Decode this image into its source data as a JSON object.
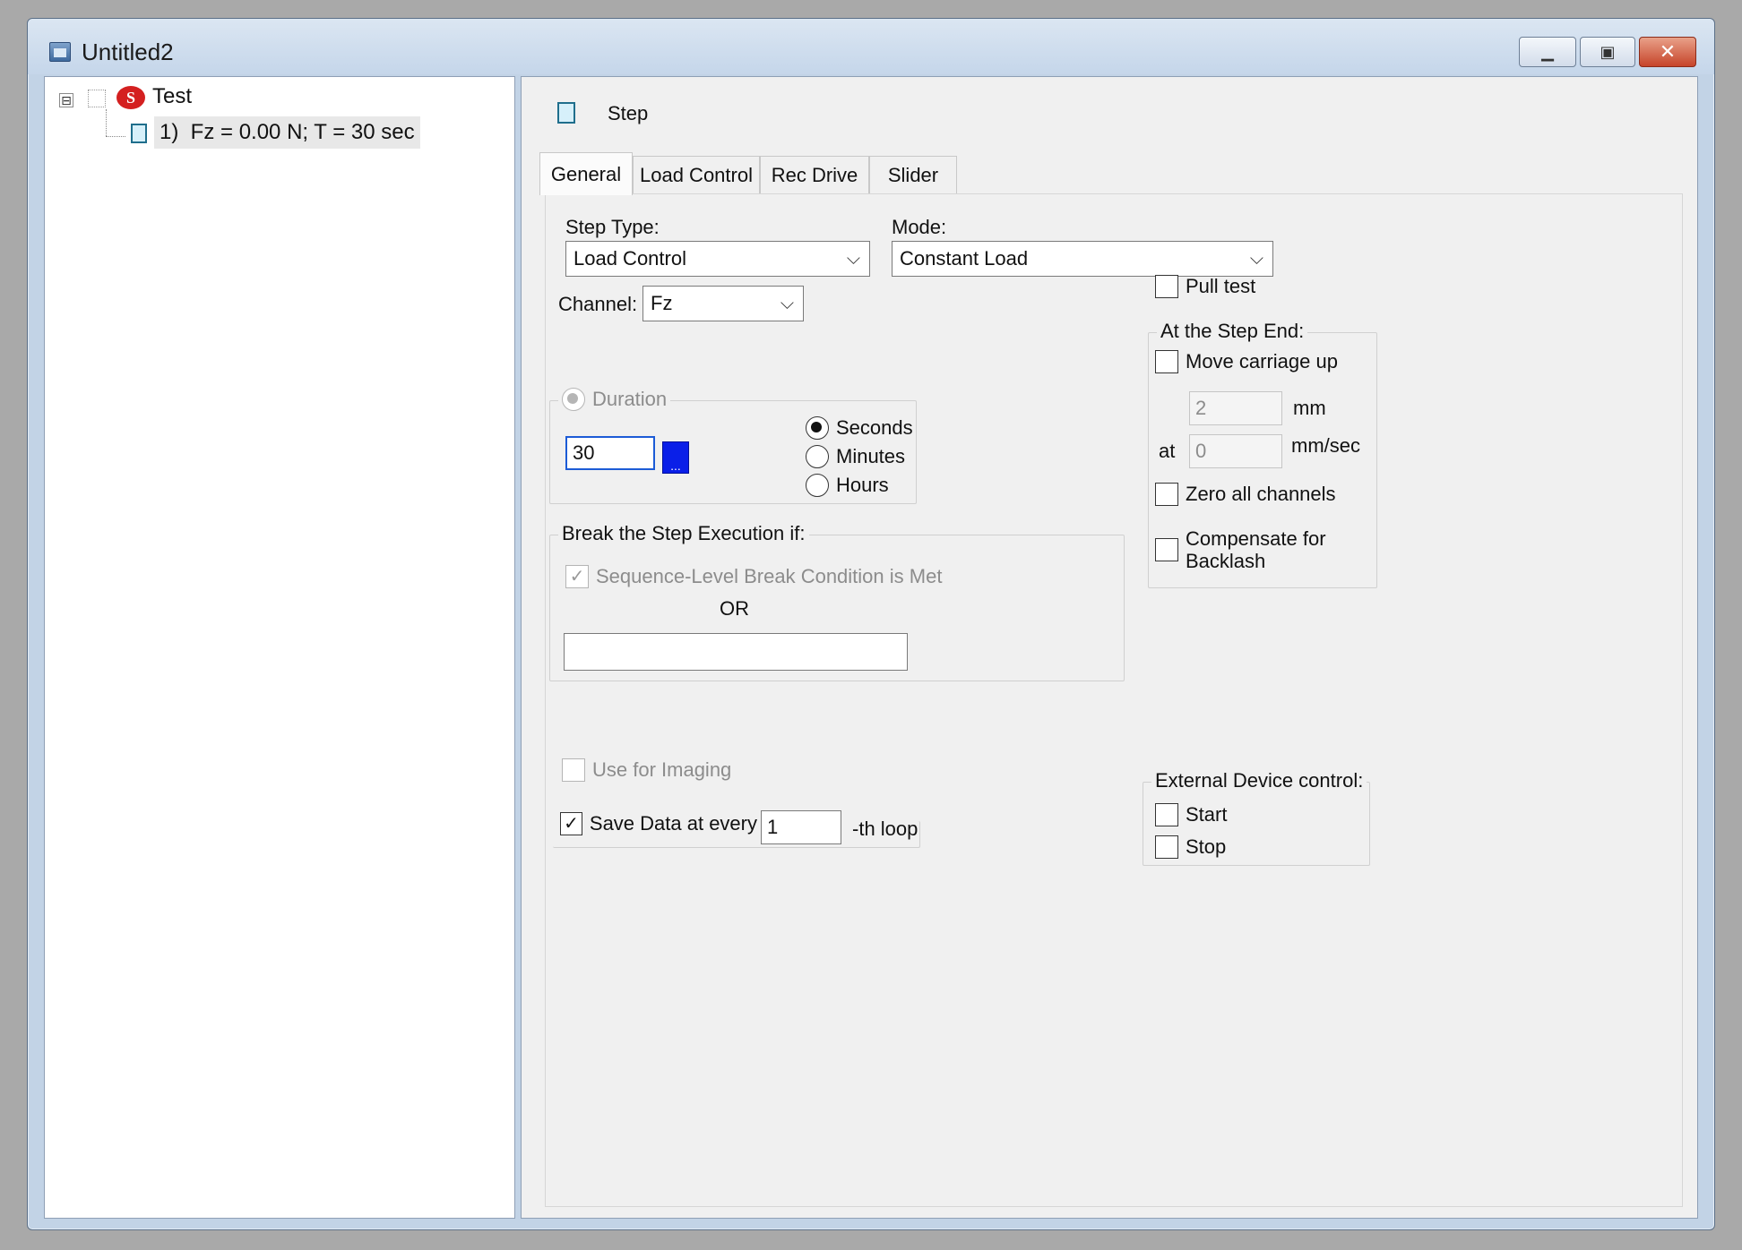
{
  "window": {
    "title": "Untitled2"
  },
  "tree": {
    "expander": "⊟",
    "root_label": "Test",
    "root_icon_letter": "S",
    "step_label": "1)  Fz = 0.00 N; T = 30 sec"
  },
  "header": {
    "heading": "Step"
  },
  "tabs": [
    "General",
    "Load Control",
    "Rec Drive",
    "Slider"
  ],
  "general": {
    "step_type_label": "Step Type:",
    "step_type_value": "Load Control",
    "mode_label": "Mode:",
    "mode_value": "Constant Load",
    "channel_label": "Channel:",
    "channel_value": "Fz",
    "duration": {
      "title": "Duration",
      "value": "30",
      "ellipsis": "...",
      "units": [
        "Seconds",
        "Minutes",
        "Hours"
      ],
      "selected_unit": "Seconds"
    },
    "break": {
      "title": "Break the Step Execution if:",
      "sequence_label": "Sequence-Level Break Condition is Met",
      "or_label": "OR",
      "condition_value": ""
    },
    "use_for_imaging_label": "Use for Imaging",
    "save_data": {
      "label": "Save Data at every",
      "value": "1",
      "suffix": "-th loop",
      "checked": true
    },
    "pull_test_label": "Pull test",
    "step_end": {
      "title": "At the Step End:",
      "move_carriage_label": "Move carriage up",
      "distance_value": "2",
      "distance_unit": "mm",
      "at_label": "at",
      "speed_value": "0",
      "speed_unit": "mm/sec",
      "zero_all_label": "Zero all channels",
      "compensate_label_1": "Compensate for",
      "compensate_label_2": "Backlash"
    },
    "external": {
      "title": "External Device control:",
      "start_label": "Start",
      "stop_label": "Stop"
    }
  },
  "colors": {
    "accent_button": "#0a1fe8",
    "close_button": "#c6442a"
  }
}
